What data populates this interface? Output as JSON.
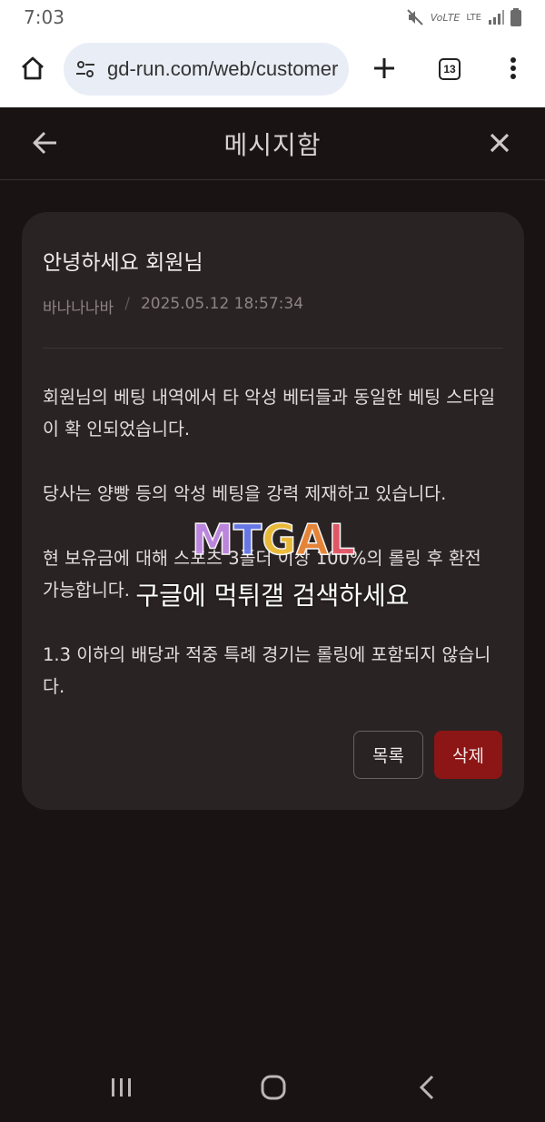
{
  "status_bar": {
    "time": "7:03",
    "volte_label": "VoLTE",
    "lte_label": "LTE"
  },
  "browser": {
    "url": "gd-run.com/web/customer",
    "tab_count": "13",
    "icons": [
      "home-icon",
      "tune-icon",
      "plus-icon",
      "tab-switcher-icon",
      "more-vert-icon"
    ]
  },
  "page": {
    "title": "메시지함",
    "icons": [
      "arrow-back-icon",
      "close-icon"
    ]
  },
  "message": {
    "title": "안녕하세요 회원님",
    "sender": "바나나나바",
    "separator": "/",
    "datetime": "2025.05.12 18:57:34",
    "paragraphs": [
      "회원님의 베팅 내역에서 타 악성 베터들과 동일한 베팅 스타일이 확 인되었습니다.",
      "당사는 양빵 등의 악성 베팅을 강력 제재하고 있습니다.",
      "현 보유금에 대해 스포츠 3폴더 이상 100%의 롤링 후 환전 가능합니다.",
      "1.3 이하의 배당과 적중 특례 경기는 롤링에 포함되지 않습니다."
    ],
    "list_button": "목록",
    "delete_button": "삭제"
  },
  "watermark": {
    "logo": "MTGAL",
    "text": "구글에 먹튀갤 검색하세요"
  },
  "colors": {
    "page_bg": "#1a1313",
    "card_bg": "#2a2323",
    "delete_bg": "#8c1515",
    "url_pill_bg": "#e9eef6"
  }
}
